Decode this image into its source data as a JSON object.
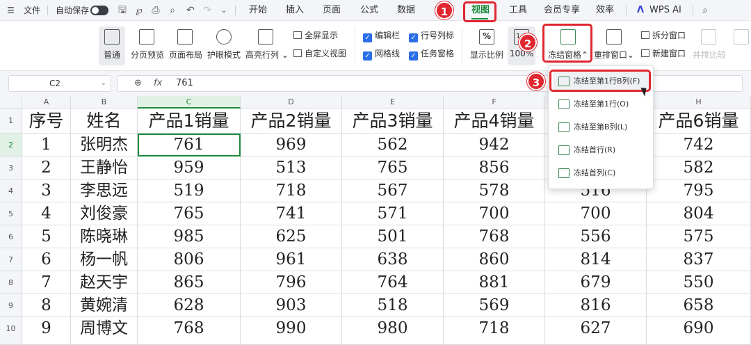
{
  "menubar": {
    "file_label": "文件",
    "autosave_label": "自动保存",
    "tabs": [
      "开始",
      "插入",
      "页面",
      "公式",
      "数据",
      "视图",
      "工具",
      "会员专享",
      "效率",
      "WPS AI"
    ],
    "active_tab": "视图"
  },
  "ribbon": {
    "normal": "普通",
    "page_break_preview": "分页预览",
    "page_layout": "页面布局",
    "eye_mode": "护眼模式",
    "highlight_row_col": "高亮行列",
    "fullscreen": "全屏显示",
    "custom_view": "自定义视图",
    "chk_edit_bar": "编辑栏",
    "chk_row_col_header": "行号列标",
    "chk_gridlines": "网格线",
    "chk_task_pane": "任务窗格",
    "zoom_ratio": "显示比例",
    "zoom_100": "100%",
    "freeze_panes": "冻结窗格",
    "arrange_windows": "重排窗口",
    "split_window": "拆分窗口",
    "new_window": "新建窗口",
    "side_by_side": "并排比较"
  },
  "markers": [
    "1",
    "2",
    "3"
  ],
  "formula_bar": {
    "name_box": "C2",
    "fx_label": "fx",
    "value": "761"
  },
  "dropdown": {
    "items": [
      "冻结至第1行B列(F)",
      "冻结至第1行(O)",
      "冻结至第B列(L)",
      "冻结首行(R)",
      "冻结首列(C)"
    ]
  },
  "sheet": {
    "col_letters": [
      "A",
      "B",
      "C",
      "D",
      "E",
      "F",
      "G",
      "H"
    ],
    "row_numbers": [
      "1",
      "2",
      "3",
      "4",
      "5",
      "6",
      "7",
      "8",
      "9",
      "10"
    ],
    "headers": [
      "序号",
      "姓名",
      "产品1销量",
      "产品2销量",
      "产品3销量",
      "产品4销量",
      "",
      "产品6销量"
    ],
    "rows": [
      [
        "1",
        "张明杰",
        "761",
        "969",
        "562",
        "942",
        "",
        "742"
      ],
      [
        "2",
        "王静怡",
        "959",
        "513",
        "765",
        "856",
        "",
        "582"
      ],
      [
        "3",
        "李思远",
        "519",
        "718",
        "567",
        "578",
        "516",
        "795"
      ],
      [
        "4",
        "刘俊豪",
        "765",
        "741",
        "571",
        "700",
        "700",
        "804"
      ],
      [
        "5",
        "陈晓琳",
        "985",
        "625",
        "501",
        "768",
        "556",
        "575"
      ],
      [
        "6",
        "杨一帆",
        "806",
        "961",
        "638",
        "860",
        "814",
        "837"
      ],
      [
        "7",
        "赵天宇",
        "865",
        "796",
        "764",
        "881",
        "679",
        "550"
      ],
      [
        "8",
        "黄婉清",
        "628",
        "903",
        "518",
        "569",
        "816",
        "658"
      ],
      [
        "9",
        "周博文",
        "768",
        "990",
        "980",
        "718",
        "627",
        "690"
      ]
    ]
  },
  "colors": {
    "accent_green": "#1a8a3c",
    "marker_red": "#e0262f",
    "checkbox_blue": "#2a6ee8"
  }
}
